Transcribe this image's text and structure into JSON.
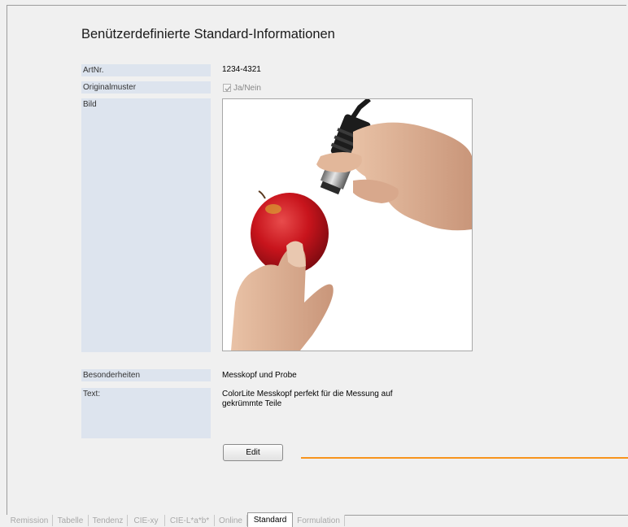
{
  "page": {
    "title": "Benützerdefinierte Standard-Informationen"
  },
  "fields": {
    "art_nr": {
      "label": "ArtNr.",
      "value": "1234-4321"
    },
    "originalmuster": {
      "label": "Originalmuster",
      "checkbox_label": "Ja/Nein",
      "checked": true
    },
    "bild": {
      "label": "Bild"
    },
    "besonderheiten": {
      "label": "Besonderheiten",
      "value": "Messkopf und Probe"
    },
    "text": {
      "label": "Text:",
      "line1": "ColorLite Messkopf  perfekt für die Messung auf",
      "line2": "gekrümmte Teile"
    }
  },
  "buttons": {
    "edit_label": "Edit"
  },
  "tabs": [
    {
      "label": "Remission",
      "active": false
    },
    {
      "label": "Tabelle",
      "active": false
    },
    {
      "label": "Tendenz",
      "active": false
    },
    {
      "label": "CIE-xy",
      "active": false
    },
    {
      "label": "CIE-L*a*b*",
      "active": false
    },
    {
      "label": "Online",
      "active": false
    },
    {
      "label": "Standard",
      "active": true
    },
    {
      "label": "Formulation",
      "active": false
    }
  ],
  "colors": {
    "label_background": "#dde4ee",
    "accent_line": "#f7941d",
    "apple_red": "#c8141c"
  }
}
